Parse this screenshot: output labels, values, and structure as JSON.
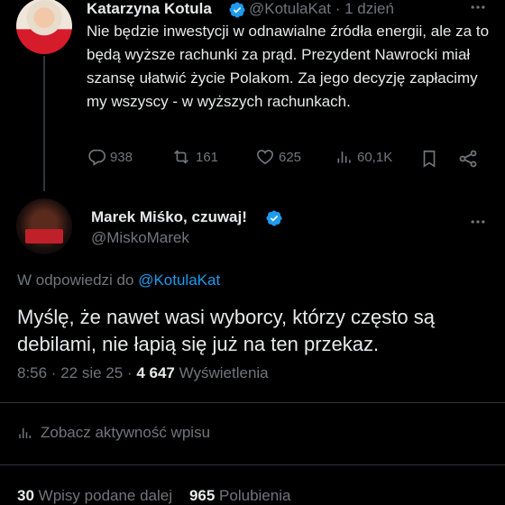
{
  "parent": {
    "name": "Katarzyna Kotula",
    "handle": "@KotulaKat",
    "time": "· 1 dzień",
    "text": "Nie będzie inwestycji w odnawialne źródła energii, ale za to będą wyższe rachunki za prąd. Prezydent Nawrocki miał szansę ułatwić życie Polakom. Za jego decyzję zapłacimy my wszyscy - w wyższych rachunkach.",
    "replies": "938",
    "reposts": "161",
    "likes": "625",
    "views": "60,1K"
  },
  "reply": {
    "name": "Marek Miśko, czuwaj!",
    "handle": "@MiskoMarek",
    "in_reply_prefix": "W odpowiedzi do",
    "in_reply_handle": "@KotulaKat",
    "text": "Myślę, że nawet wasi wyborcy, którzy często są debilami, nie łapią się już na ten przekaz.",
    "time": "8:56 · 22 sie 25 ·",
    "views_count": "4 647",
    "views_label": "Wyświetlenia",
    "activity_label": "Zobacz aktywność wpisu",
    "reposts_count": "30",
    "reposts_label": "Wpisy podane dalej",
    "likes_count": "965",
    "likes_label": "Polubienia"
  },
  "colors": {
    "accent": "#1d9bf0",
    "muted": "#71767b",
    "background": "#000000"
  }
}
